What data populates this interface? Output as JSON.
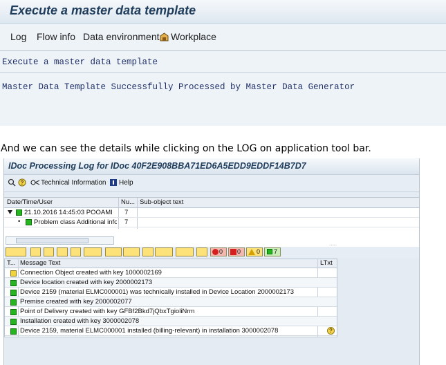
{
  "top_window": {
    "title": "Execute a master data template",
    "menu": [
      "Log",
      "Flow info",
      "Data environment",
      "Workplace"
    ],
    "subtitle": "Execute a master data template",
    "status_message": "Master Data Template Successfully Processed by Master Data Generator"
  },
  "caption": "And we can see the details while clicking on the LOG on application tool bar.",
  "log_window": {
    "title": "IDoc Processing Log for IDoc 40F2E908BBA71ED6A5EDD9EDDF14B7D7",
    "toolbar": {
      "technical_information": "Technical Information",
      "help": "Help"
    },
    "tree": {
      "columns": [
        "Date/Time/User",
        "Nu...",
        "Sub-object text"
      ],
      "rows": [
        {
          "text": "21.10.2016  14:45:03  POOAMI",
          "number": "7"
        },
        {
          "text": "Problem class Additional inform",
          "number": "7"
        }
      ]
    },
    "alv_counters": {
      "stop": "0",
      "error": "0",
      "warning": "0",
      "success": "7"
    },
    "messages": {
      "columns": [
        "T...",
        "Message Text",
        "LTxt"
      ],
      "rows": [
        {
          "type": "warning",
          "text": "Connection Object created with key 1000002169"
        },
        {
          "type": "success",
          "text": "Device location created with key 2000002173"
        },
        {
          "type": "success",
          "text": "Device 2159 (material ELMC000001) was technically installed in Device Location 2000002173"
        },
        {
          "type": "success",
          "text": "Premise created with key 2000002077"
        },
        {
          "type": "success",
          "text": "Point of Delivery created with key GFBf2Bkd7jQbxTgioliNrm"
        },
        {
          "type": "success",
          "text": "Installation created with key 3000002078"
        },
        {
          "type": "success",
          "text": "Device 2159, material ELMC000001 installed (billing-relevant) in installation 3000002078",
          "ltxt": "?"
        }
      ]
    },
    "colors": {
      "success_led": "#25b51e",
      "warning_led": "#f3d33a",
      "button_yellow": "#fde27a"
    }
  }
}
